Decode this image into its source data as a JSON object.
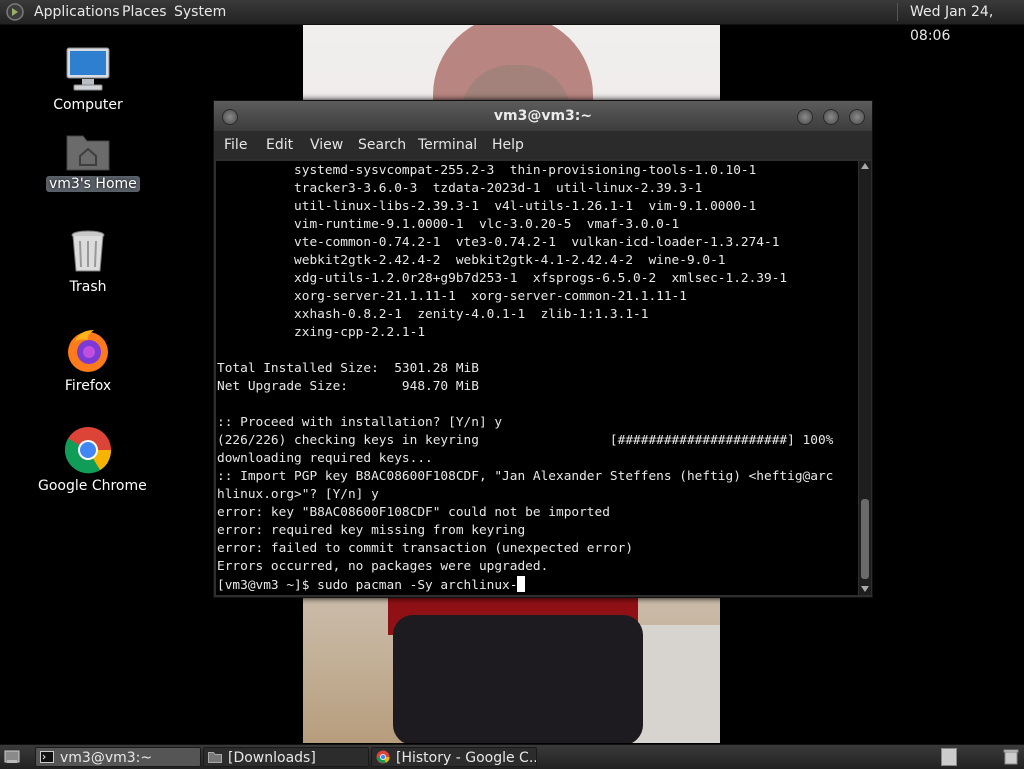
{
  "top_panel": {
    "menus": [
      "Applications",
      "Places",
      "System"
    ],
    "clock": "Wed Jan 24, 08:06"
  },
  "desktop": {
    "icons": [
      {
        "label": "Computer",
        "icon": "computer-icon"
      },
      {
        "label": "vm3's Home",
        "icon": "home-folder-icon"
      },
      {
        "label": "Trash",
        "icon": "trash-icon"
      },
      {
        "label": "Firefox",
        "icon": "firefox-icon"
      },
      {
        "label": "Google Chrome",
        "icon": "chrome-icon"
      }
    ]
  },
  "terminal": {
    "title": "vm3@vm3:~",
    "menu": [
      "File",
      "Edit",
      "View",
      "Search",
      "Terminal",
      "Help"
    ],
    "lines": [
      "          systemd-sysvcompat-255.2-3  thin-provisioning-tools-1.0.10-1",
      "          tracker3-3.6.0-3  tzdata-2023d-1  util-linux-2.39.3-1",
      "          util-linux-libs-2.39.3-1  v4l-utils-1.26.1-1  vim-9.1.0000-1",
      "          vim-runtime-9.1.0000-1  vlc-3.0.20-5  vmaf-3.0.0-1",
      "          vte-common-0.74.2-1  vte3-0.74.2-1  vulkan-icd-loader-1.3.274-1",
      "          webkit2gtk-2.42.4-2  webkit2gtk-4.1-2.42.4-2  wine-9.0-1",
      "          xdg-utils-1.2.0r28+g9b7d253-1  xfsprogs-6.5.0-2  xmlsec-1.2.39-1",
      "          xorg-server-21.1.11-1  xorg-server-common-21.1.11-1",
      "          xxhash-0.8.2-1  zenity-4.0.1-1  zlib-1:1.3.1-1",
      "          zxing-cpp-2.2.1-1",
      "",
      "Total Installed Size:  5301.28 MiB",
      "Net Upgrade Size:       948.70 MiB",
      "",
      ":: Proceed with installation? [Y/n] y",
      "(226/226) checking keys in keyring                 [######################] 100%",
      "downloading required keys...",
      ":: Import PGP key B8AC08600F108CDF, \"Jan Alexander Steffens (heftig) <heftig@arc",
      "hlinux.org>\"? [Y/n] y",
      "error: key \"B8AC08600F108CDF\" could not be imported",
      "error: required key missing from keyring",
      "error: failed to commit transaction (unexpected error)",
      "Errors occurred, no packages were upgraded."
    ],
    "prompt": "[vm3@vm3 ~]$ sudo pacman -Sy archlinux-"
  },
  "taskbar": {
    "tasks": [
      {
        "label": "vm3@vm3:~",
        "icon": "terminal-icon",
        "active": true
      },
      {
        "label": "[Downloads]",
        "icon": "folder-icon",
        "active": false
      },
      {
        "label": "[History - Google C...",
        "icon": "chrome-icon",
        "active": false
      }
    ]
  }
}
